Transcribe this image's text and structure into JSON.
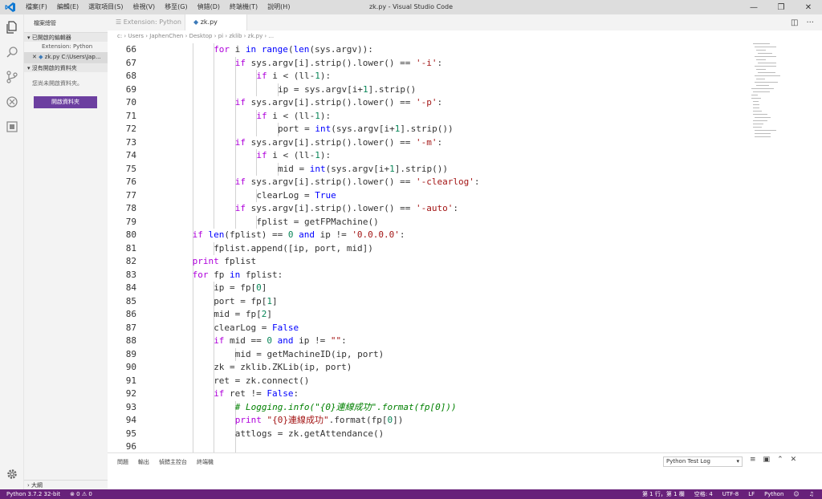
{
  "titlebar": {
    "title": "zk.py - Visual Studio Code",
    "menu": [
      "檔案(F)",
      "編輯(E)",
      "選取項目(S)",
      "檢視(V)",
      "移至(G)",
      "偵錯(D)",
      "終端機(T)",
      "說明(H)"
    ]
  },
  "sidebar": {
    "title": "檔案總管",
    "open_editors_label": "已開啟的編輯器",
    "files": [
      {
        "name": "Extension: Python",
        "active": false
      },
      {
        "name": "zk.py  C:\\Users\\Jap...",
        "active": true
      }
    ],
    "no_folder_label": "沒有開啟的資料夾",
    "empty_message": "您尚未開啟資料夾。",
    "open_folder_button": "開啟資料夾",
    "outline_label": "大綱"
  },
  "tabs": [
    {
      "label": "Extension: Python",
      "active": false
    },
    {
      "label": "zk.py",
      "active": true
    }
  ],
  "breadcrumb": "c: › Users › JaphenChen › Desktop › pi › zklib › zk.py › ...",
  "code": [
    {
      "n": "66",
      "indent": 3,
      "html": "<span class=\"ctl\">for</span> i <span class=\"kw\">in</span> <span class=\"kw\">range</span>(<span class=\"kw\">len</span>(sys.argv)):"
    },
    {
      "n": "67",
      "indent": 4,
      "html": "<span class=\"ctl\">if</span> sys.argv[i].strip().lower() == <span class=\"str\">'-i'</span>:"
    },
    {
      "n": "68",
      "indent": 5,
      "html": "<span class=\"ctl\">if</span> i &lt; (ll-<span class=\"num\">1</span>):"
    },
    {
      "n": "69",
      "indent": 6,
      "html": "ip = sys.argv[i+<span class=\"num\">1</span>].strip()"
    },
    {
      "n": "70",
      "indent": 4,
      "html": "<span class=\"ctl\">if</span> sys.argv[i].strip().lower() == <span class=\"str\">'-p'</span>:"
    },
    {
      "n": "71",
      "indent": 5,
      "html": "<span class=\"ctl\">if</span> i &lt; (ll-<span class=\"num\">1</span>):"
    },
    {
      "n": "72",
      "indent": 6,
      "html": "port = <span class=\"kw\">int</span>(sys.argv[i+<span class=\"num\">1</span>].strip())"
    },
    {
      "n": "73",
      "indent": 4,
      "html": "<span class=\"ctl\">if</span> sys.argv[i].strip().lower() == <span class=\"str\">'-m'</span>:"
    },
    {
      "n": "74",
      "indent": 5,
      "html": "<span class=\"ctl\">if</span> i &lt; (ll-<span class=\"num\">1</span>):"
    },
    {
      "n": "75",
      "indent": 6,
      "html": "mid = <span class=\"kw\">int</span>(sys.argv[i+<span class=\"num\">1</span>].strip())"
    },
    {
      "n": "76",
      "indent": 4,
      "html": "<span class=\"ctl\">if</span> sys.argv[i].strip().lower() == <span class=\"str\">'-clearlog'</span>:"
    },
    {
      "n": "77",
      "indent": 5,
      "html": "clearLog = <span class=\"kw\">True</span>"
    },
    {
      "n": "78",
      "indent": 4,
      "html": "<span class=\"ctl\">if</span> sys.argv[i].strip().lower() == <span class=\"str\">'-auto'</span>:"
    },
    {
      "n": "79",
      "indent": 5,
      "html": "fplist = getFPMachine()"
    },
    {
      "n": "80",
      "indent": 2,
      "html": "<span class=\"ctl\">if</span> <span class=\"kw\">len</span>(fplist) == <span class=\"num\">0</span> <span class=\"kw\">and</span> ip != <span class=\"str\">'0.0.0.0'</span>:"
    },
    {
      "n": "81",
      "indent": 3,
      "html": "fplist.append([ip, port, mid])"
    },
    {
      "n": "82",
      "indent": 2,
      "html": "<span class=\"ctl\">print</span> fplist"
    },
    {
      "n": "83",
      "indent": 2,
      "html": "<span class=\"ctl\">for</span> fp <span class=\"kw\">in</span> fplist:"
    },
    {
      "n": "84",
      "indent": 3,
      "html": "ip = fp[<span class=\"num\">0</span>]"
    },
    {
      "n": "85",
      "indent": 3,
      "html": "port = fp[<span class=\"num\">1</span>]"
    },
    {
      "n": "86",
      "indent": 3,
      "html": "mid = fp[<span class=\"num\">2</span>]"
    },
    {
      "n": "87",
      "indent": 3,
      "html": "clearLog = <span class=\"kw\">False</span>"
    },
    {
      "n": "88",
      "indent": 3,
      "html": "<span class=\"ctl\">if</span> mid == <span class=\"num\">0</span> <span class=\"kw\">and</span> ip != <span class=\"str\">\"\"</span>:"
    },
    {
      "n": "89",
      "indent": 4,
      "html": "mid = getMachineID(ip, port)"
    },
    {
      "n": "90",
      "indent": 3,
      "html": "zk = zklib.ZKLib(ip, port)"
    },
    {
      "n": "91",
      "indent": 3,
      "html": "ret = zk.connect()"
    },
    {
      "n": "92",
      "indent": 3,
      "html": "<span class=\"ctl\">if</span> ret != <span class=\"kw\">False</span>:"
    },
    {
      "n": "93",
      "indent": 4,
      "html": "<span class=\"cmt\"># Logging.info(\"{0}連線成功\".format(fp[0]))</span>"
    },
    {
      "n": "94",
      "indent": 4,
      "html": "<span class=\"ctl\">print</span> <span class=\"str\">\"{0}連線成功\"</span>.format(fp[<span class=\"num\">0</span>])"
    },
    {
      "n": "95",
      "indent": 4,
      "html": "attlogs = zk.getAttendance()"
    },
    {
      "n": "96",
      "indent": 4,
      "html": ""
    }
  ],
  "panel": {
    "tabs": [
      "問題",
      "輸出",
      "偵錯主控台",
      "終端機"
    ],
    "output_channel": "Python Test Log"
  },
  "statusbar": {
    "interpreter": "Python 3.7.2 32-bit",
    "problems": "⊗ 0  ⚠ 0",
    "position": "第 1 行，第 1 欄",
    "indent": "空格: 4",
    "encoding": "UTF-8",
    "eol": "LF",
    "language": "Python"
  },
  "colors": {
    "statusbar": "#68217a",
    "open_folder_button": "#6c3fa0",
    "keyword": "#0000ff",
    "control": "#af00db",
    "string": "#a31515",
    "number": "#098658",
    "comment": "#008000"
  }
}
